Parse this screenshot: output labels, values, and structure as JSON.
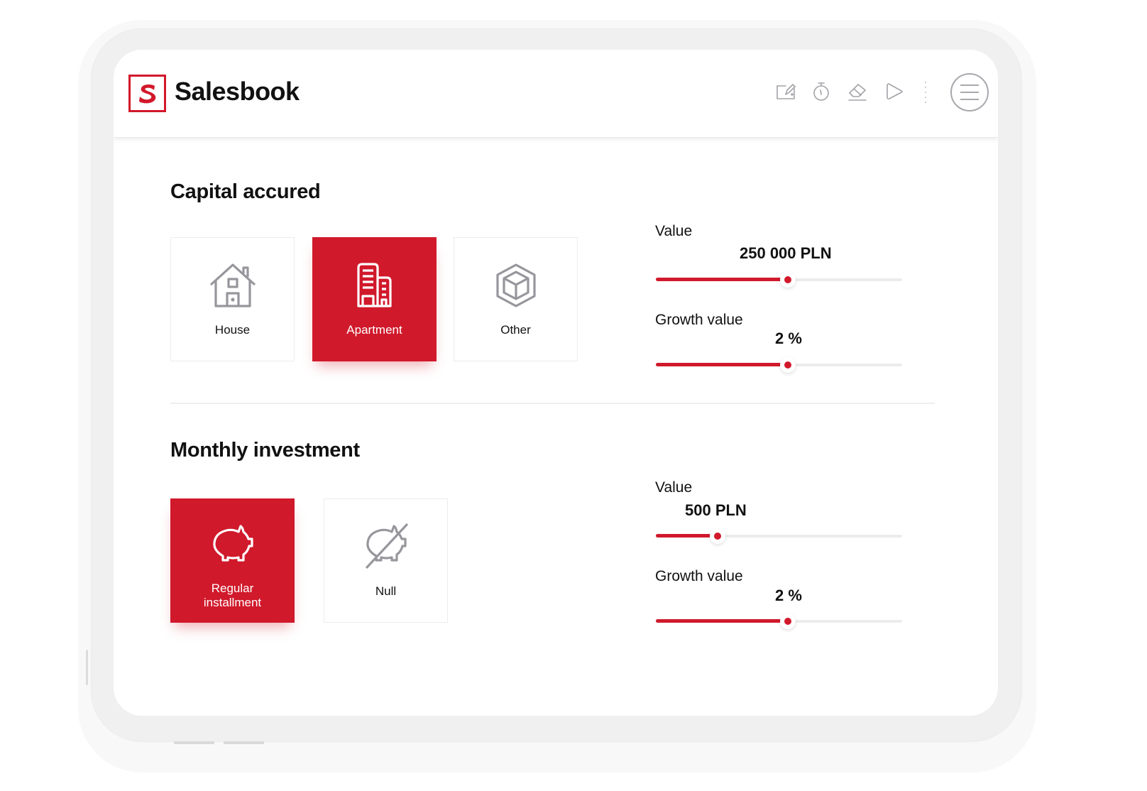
{
  "app": {
    "brand_name": "Salesbook",
    "logo_letter": "S",
    "accent_color": "#d0192b"
  },
  "toolbar": {
    "icons": [
      {
        "name": "edit-note-icon"
      },
      {
        "name": "stopwatch-icon"
      },
      {
        "name": "eraser-icon"
      },
      {
        "name": "play-icon"
      }
    ],
    "menu_icon": "hamburger-menu-icon"
  },
  "sections": [
    {
      "title": "Capital accured",
      "options": [
        {
          "label": "House",
          "icon": "house-icon",
          "selected": false
        },
        {
          "label": "Apartment",
          "icon": "apartment-building-icon",
          "selected": true
        },
        {
          "label": "Other",
          "icon": "cube-icon",
          "selected": false
        }
      ],
      "controls": [
        {
          "label": "Value",
          "value": "250 000 PLN",
          "fraction": 0.535
        },
        {
          "label": "Growth value",
          "value": "2 %",
          "fraction": 0.535
        }
      ]
    },
    {
      "title": "Monthly investment",
      "options": [
        {
          "label": "Regular installment",
          "label_line1": "Regular",
          "label_line2": "installment",
          "icon": "piggy-bank-icon",
          "selected": true
        },
        {
          "label": "Null",
          "icon": "piggy-bank-crossed-icon",
          "selected": false
        }
      ],
      "controls": [
        {
          "label": "Value",
          "value": "500 PLN",
          "fraction": 0.25
        },
        {
          "label": "Growth value",
          "value": "2 %",
          "fraction": 0.535
        }
      ]
    }
  ]
}
